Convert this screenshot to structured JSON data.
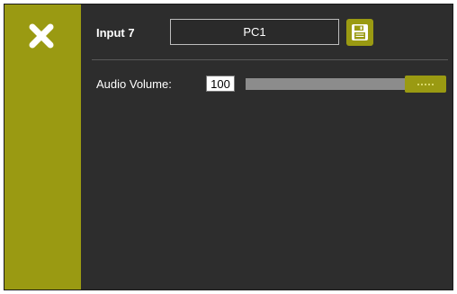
{
  "header": {
    "input_label": "Input 7",
    "input_name_value": "PC1",
    "close_icon": "close-icon",
    "save_icon": "save-icon"
  },
  "audio": {
    "label": "Audio Volume:",
    "value": "100",
    "slider_fraction": 1.0
  },
  "colors": {
    "accent": "#9a9a12",
    "background": "#2d2d2d",
    "slider_track": "#8c8c8c"
  }
}
